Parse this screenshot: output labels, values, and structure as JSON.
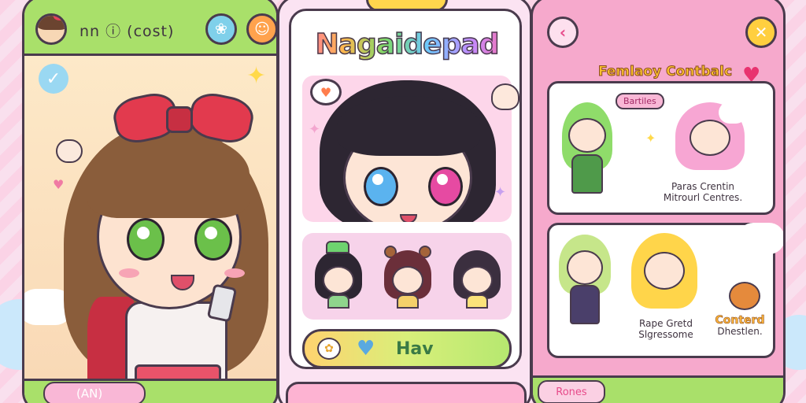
{
  "left_screen": {
    "title": "nn ⓘ (cost)",
    "blue_button_icon": "chat-bubble-icon",
    "orange_button_icon": "smiley-icon",
    "bottom_pill": "(AN)"
  },
  "middle_screen": {
    "logo": "Nagaidepad",
    "action_button_label": "Hav"
  },
  "right_screen": {
    "heading": "Femlaoy Contbalc",
    "card1": {
      "tag": "Bartiles",
      "caption_line1": "Paras Crentin",
      "caption_line2": "Mitrourl Centres."
    },
    "card2": {
      "caption_left_line1": "Rape Gretd",
      "caption_left_line2": "Slgressome",
      "caption_right_title": "Conterd",
      "caption_right_line2": "Dhestlen."
    },
    "bottom_pill": "Rones"
  },
  "colors": {
    "accent_pink": "#f6a9cc",
    "accent_green": "#a9e06a",
    "accent_yellow": "#ffd64d"
  }
}
